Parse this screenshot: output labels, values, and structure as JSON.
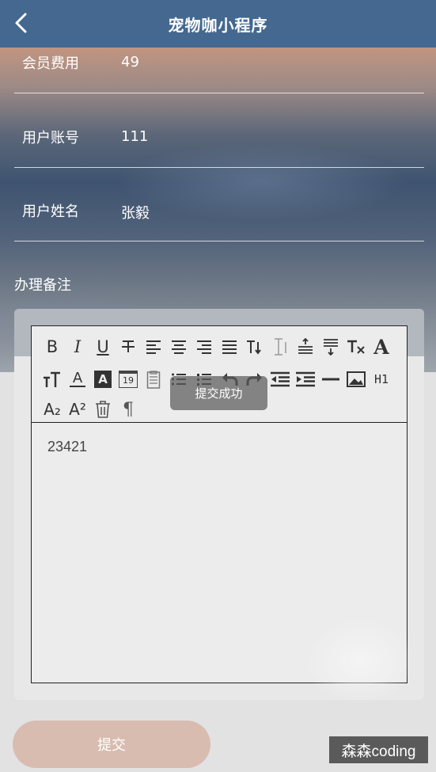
{
  "navbar": {
    "title": "宠物咖小程序"
  },
  "fields": [
    {
      "label": "会员费用",
      "value": "49"
    },
    {
      "label": "用户账号",
      "value": "111"
    },
    {
      "label": "用户姓名",
      "value": "张毅"
    }
  ],
  "remark": {
    "label": "办理备注"
  },
  "editor": {
    "content": "23421",
    "toolbar_icons": [
      "bold-icon",
      "italic-icon",
      "underline-icon",
      "strikethrough-icon",
      "align-left-icon",
      "align-center-icon",
      "align-right-icon",
      "align-justify-icon",
      "text-direction-icon",
      "line-height-icon",
      "space-above-icon",
      "space-below-icon",
      "clear-format-icon",
      "font-icon",
      "font-size-icon",
      "font-color-icon",
      "background-color-icon",
      "calendar-icon",
      "clipboard-icon",
      "ordered-list-icon",
      "unordered-list-icon",
      "undo-icon",
      "redo-icon",
      "outdent-icon",
      "indent-icon",
      "horizontal-rule-icon",
      "image-icon",
      "heading-icon",
      "subscript-icon",
      "superscript-icon",
      "trash-icon",
      "paragraph-icon"
    ],
    "toolbar_text": {
      "bold": "B",
      "italic": "I",
      "underline": "U",
      "font": "A",
      "font_color": "A",
      "bg_color": "A",
      "calendar_day": "19",
      "heading": "H1",
      "subscript": "A₂",
      "superscript": "A²",
      "paragraph": "¶"
    }
  },
  "toast": {
    "text": "提交成功"
  },
  "submit": {
    "label": "提交"
  },
  "watermark": {
    "text": "森森coding"
  },
  "colors": {
    "navbar": "#44688f",
    "submit_button": "#d8bcb0",
    "toast": "#5a5a5a"
  }
}
